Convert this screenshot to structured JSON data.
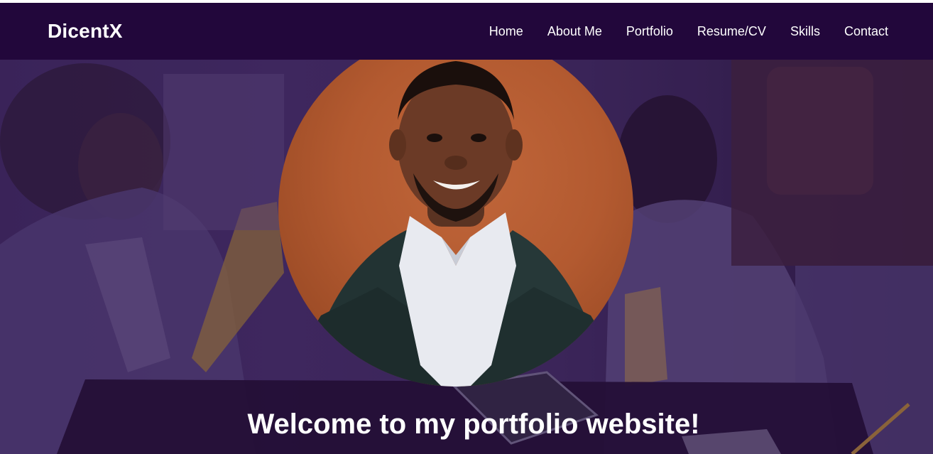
{
  "brand": {
    "name": "DicentX"
  },
  "nav": {
    "items": [
      {
        "label": "Home"
      },
      {
        "label": "About Me"
      },
      {
        "label": "Portfolio"
      },
      {
        "label": "Resume/CV"
      },
      {
        "label": "Skills"
      },
      {
        "label": "Contact"
      }
    ]
  },
  "hero": {
    "title": "Welcome to my portfolio website!"
  },
  "icons": {
    "profile": "profile-photo",
    "background": "office-background-image"
  },
  "colors": {
    "navbar": "#22073b",
    "hero_overlay": "#3b2756",
    "photo_background": "#b35a30",
    "text": "#ffffff"
  }
}
